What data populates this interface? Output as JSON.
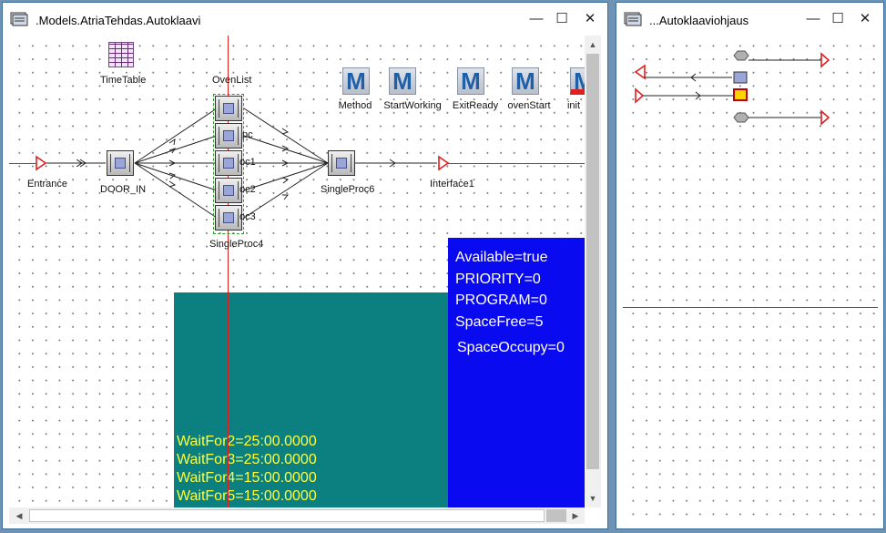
{
  "window_left": {
    "title": ".Models.AtriaTehdas.Autoklaavi",
    "objects": {
      "timetable": "TimeTable",
      "ovenlist": "OvenList",
      "entrance": "Entrance",
      "door_in": "DOOR_IN",
      "singleproc4": "SingleProc4",
      "singleproc6": "SingleProc6",
      "interface1": "Interface1"
    },
    "parallel_labels": [
      "pc",
      "oc1",
      "oc2",
      "oc3"
    ],
    "methods": [
      {
        "letter": "M",
        "label": "Method"
      },
      {
        "letter": "M",
        "label": "StartWorking"
      },
      {
        "letter": "M",
        "label": "ExitReady"
      },
      {
        "letter": "M",
        "label": "ovenStart"
      },
      {
        "letter": "M",
        "label": "init"
      }
    ],
    "blue_panel": [
      "Available=true",
      "PRIORITY=0",
      "PROGRAM=0",
      "SpaceFree=5",
      "SpaceOccupy=0"
    ],
    "teal_panel": [
      "WaitFor2=25:00.0000",
      "WaitFor3=25:00.0000",
      "WaitFor4=15:00.0000",
      "WaitFor5=15:00.0000"
    ],
    "scroll_up": "▲",
    "scroll_down": "▼",
    "scroll_left": "◀",
    "scroll_right": "▶"
  },
  "window_right": {
    "title": "...Autoklaaviohjaus"
  },
  "window_controls": {
    "minimize": "—",
    "maximize": "☐",
    "close": "✕"
  },
  "colors": {
    "desktop": "#6f93b5",
    "connector": "#e11e1e",
    "blue_panel": "#0a0af0",
    "teal_panel": "#0c8080",
    "teal_text": "#ffff3c"
  }
}
